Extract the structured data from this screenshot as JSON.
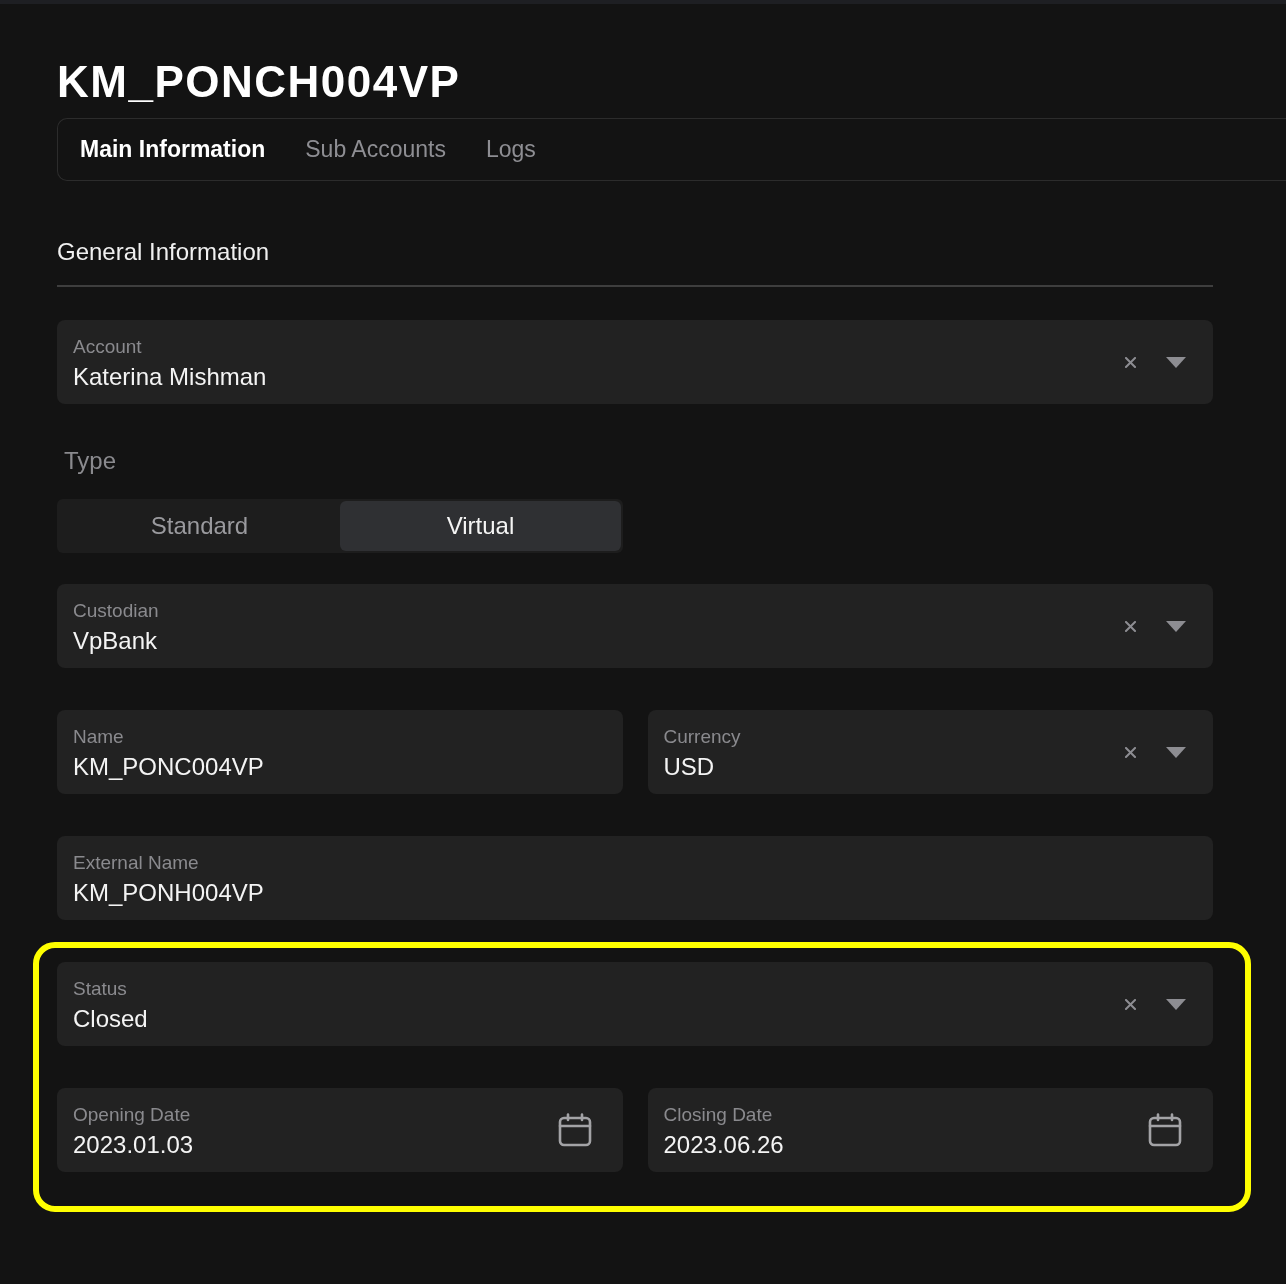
{
  "page": {
    "title": "KM_PONCH004VP"
  },
  "tabs": [
    {
      "label": "Main Information",
      "selected": true
    },
    {
      "label": "Sub Accounts",
      "selected": false
    },
    {
      "label": "Logs",
      "selected": false
    }
  ],
  "section": {
    "title": "General Information"
  },
  "rows": [
    {
      "kind": "fields",
      "highlighted": false,
      "fields": [
        {
          "kind": "select",
          "label": "Account",
          "value": "Katerina Mishman"
        }
      ]
    },
    {
      "kind": "toggle",
      "highlighted": false,
      "label": "Type",
      "options": [
        {
          "label": "Standard",
          "selected": false
        },
        {
          "label": "Virtual",
          "selected": true
        }
      ]
    },
    {
      "kind": "fields",
      "highlighted": false,
      "fields": [
        {
          "kind": "select",
          "label": "Custodian",
          "value": "VpBank"
        }
      ]
    },
    {
      "kind": "fields",
      "highlighted": false,
      "fields": [
        {
          "kind": "text",
          "label": "Name",
          "value": "KM_PONC004VP"
        },
        {
          "kind": "select",
          "label": "Currency",
          "value": "USD"
        }
      ]
    },
    {
      "kind": "fields",
      "highlighted": false,
      "fields": [
        {
          "kind": "text",
          "label": "External Name",
          "value": "KM_PONH004VP"
        }
      ]
    },
    {
      "kind": "fields",
      "highlighted": true,
      "fields": [
        {
          "kind": "select",
          "label": "Status",
          "value": "Closed"
        }
      ]
    },
    {
      "kind": "fields",
      "highlighted": true,
      "fields": [
        {
          "kind": "date",
          "label": "Opening Date",
          "value": "2023.01.03"
        },
        {
          "kind": "date",
          "label": "Closing Date",
          "value": "2023.06.26"
        }
      ]
    }
  ]
}
